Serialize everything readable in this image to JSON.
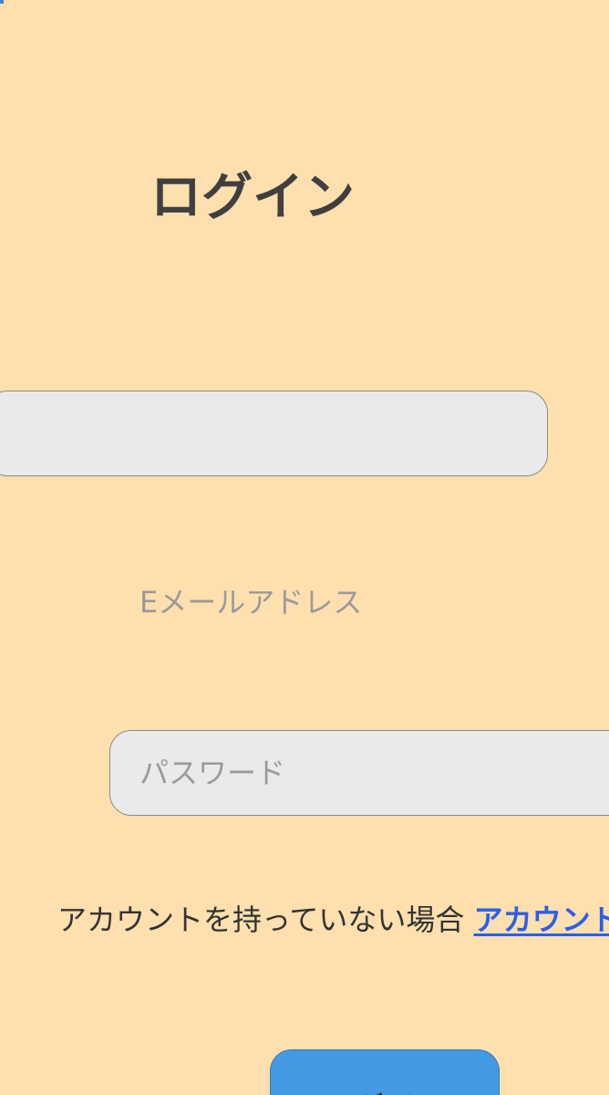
{
  "login_form": {
    "title": "ログイン",
    "email": {
      "value": "",
      "placeholder": "",
      "label": "Eメールアドレス"
    },
    "password": {
      "value": "",
      "placeholder": "パスワード"
    },
    "signup": {
      "prompt": "アカウントを持っていない場合",
      "link_label": "アカウント作成"
    },
    "submit_label": "ログイン"
  },
  "colors": {
    "background": "#FEDFAE",
    "input_fill": "#EAEAEA",
    "link": "#2C5EE8",
    "button": "#4499E4",
    "title_text": "#3F3F3F"
  }
}
